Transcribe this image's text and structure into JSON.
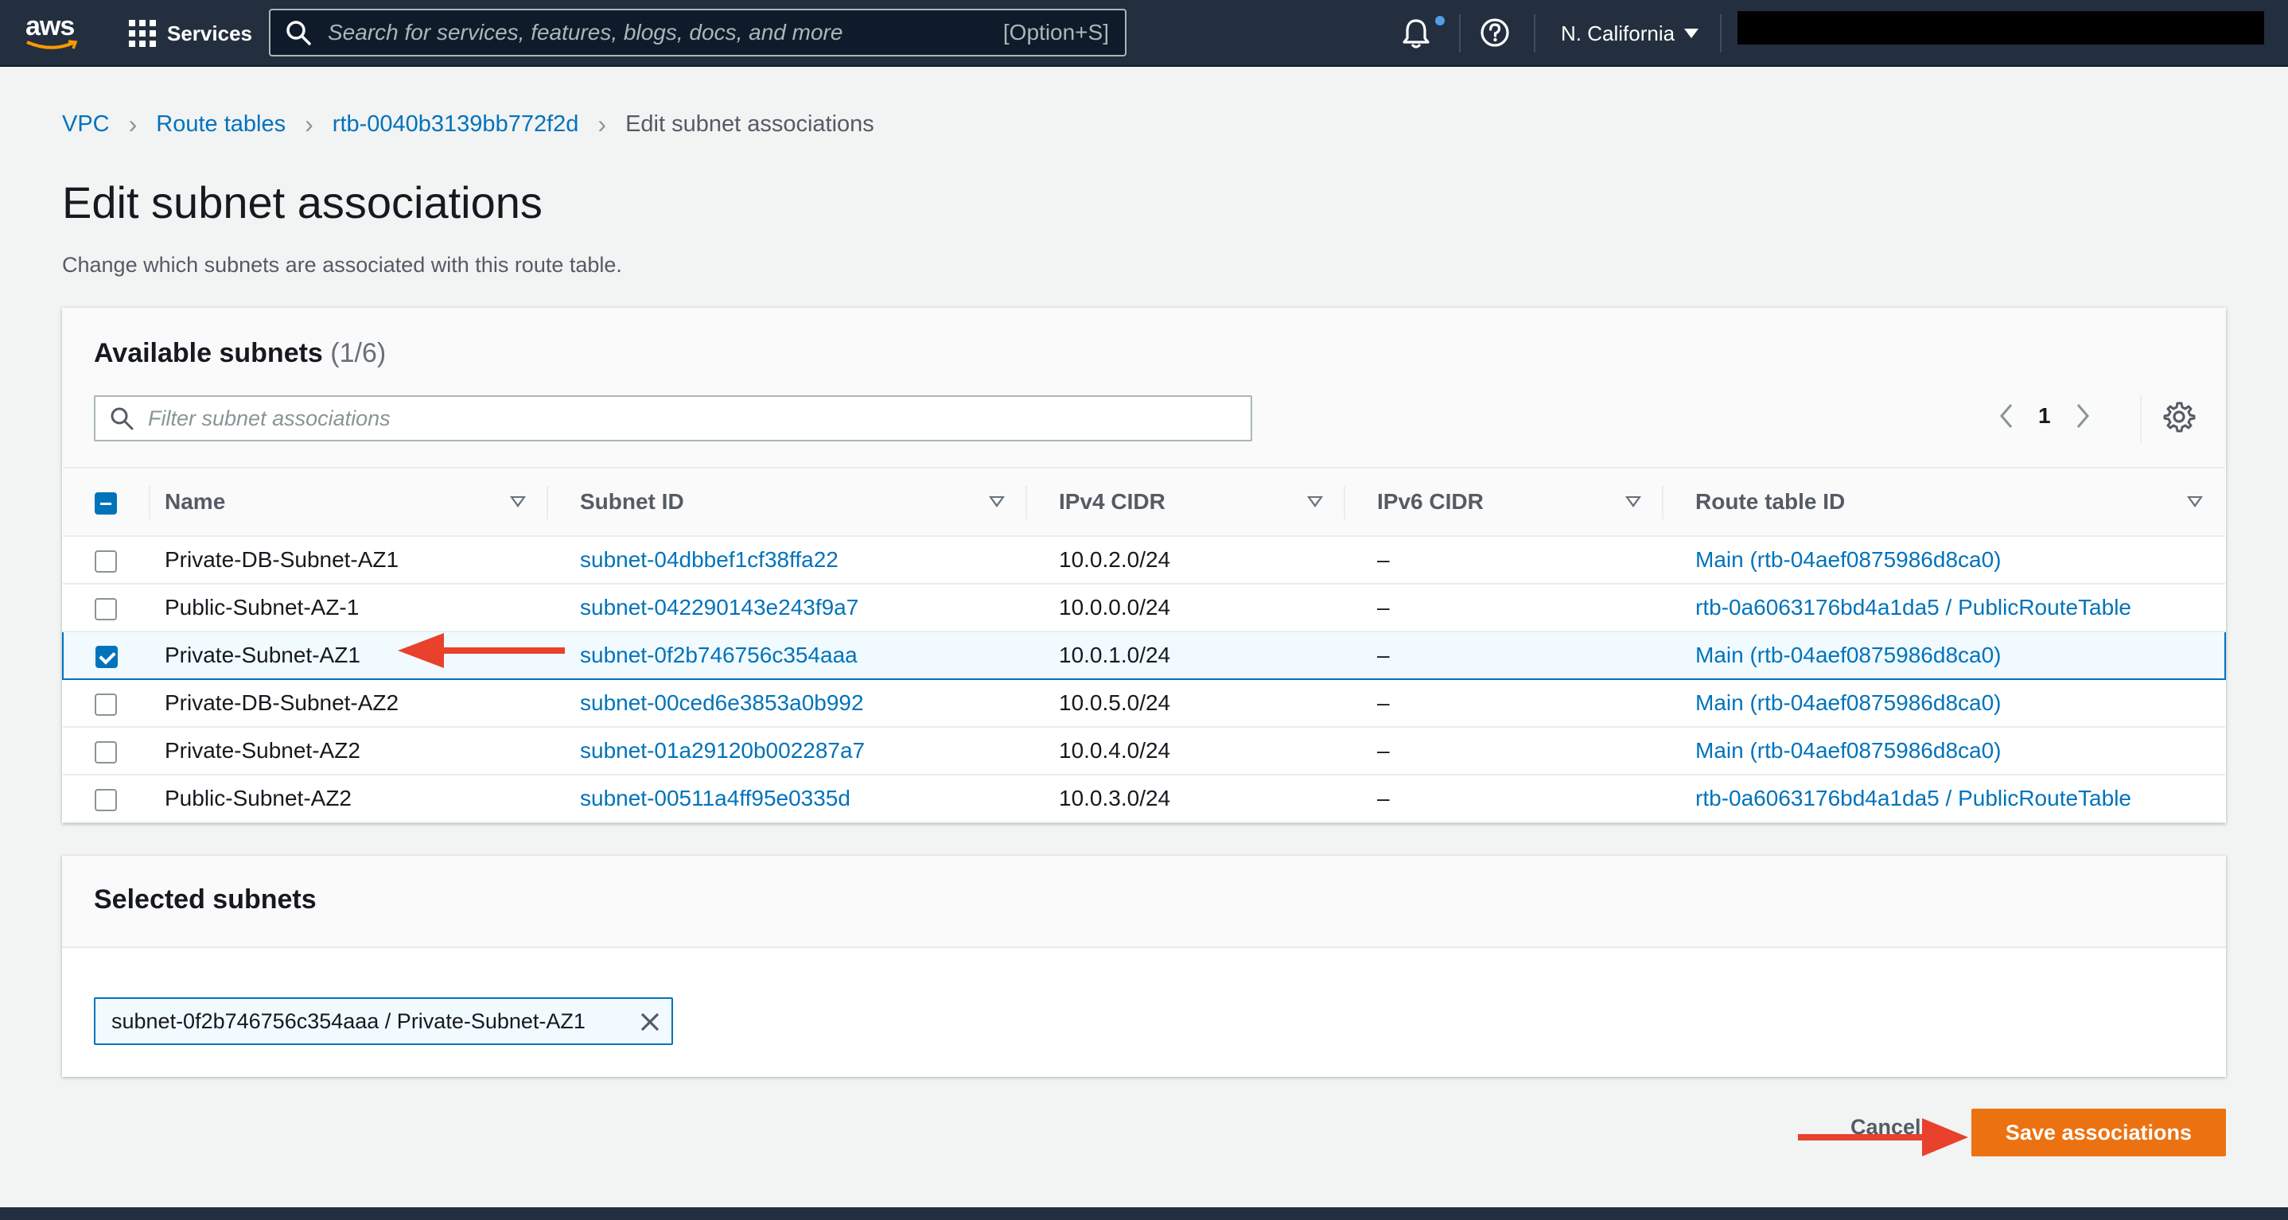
{
  "nav": {
    "logo": "aws",
    "services_label": "Services",
    "search_placeholder": "Search for services, features, blogs, docs, and more",
    "search_shortcut": "[Option+S]",
    "region": "N. California"
  },
  "breadcrumb": {
    "items": [
      "VPC",
      "Route tables",
      "rtb-0040b3139bb772f2d"
    ],
    "current": "Edit subnet associations"
  },
  "page": {
    "title": "Edit subnet associations",
    "description": "Change which subnets are associated with this route table."
  },
  "available": {
    "title": "Available subnets",
    "count": "(1/6)",
    "filter_placeholder": "Filter subnet associations",
    "page_number": "1",
    "columns": [
      "Name",
      "Subnet ID",
      "IPv4 CIDR",
      "IPv6 CIDR",
      "Route table ID"
    ],
    "rows": [
      {
        "name": "Private-DB-Subnet-AZ1",
        "subnet_id": "subnet-04dbbef1cf38ffa22",
        "ipv4": "10.0.2.0/24",
        "ipv6": "–",
        "route_table": "Main (rtb-04aef0875986d8ca0)",
        "checked": false
      },
      {
        "name": "Public-Subnet-AZ-1",
        "subnet_id": "subnet-042290143e243f9a7",
        "ipv4": "10.0.0.0/24",
        "ipv6": "–",
        "route_table": "rtb-0a6063176bd4a1da5 / PublicRouteTable",
        "checked": false
      },
      {
        "name": "Private-Subnet-AZ1",
        "subnet_id": "subnet-0f2b746756c354aaa",
        "ipv4": "10.0.1.0/24",
        "ipv6": "–",
        "route_table": "Main (rtb-04aef0875986d8ca0)",
        "checked": true
      },
      {
        "name": "Private-DB-Subnet-AZ2",
        "subnet_id": "subnet-00ced6e3853a0b992",
        "ipv4": "10.0.5.0/24",
        "ipv6": "–",
        "route_table": "Main (rtb-04aef0875986d8ca0)",
        "checked": false
      },
      {
        "name": "Private-Subnet-AZ2",
        "subnet_id": "subnet-01a29120b002287a7",
        "ipv4": "10.0.4.0/24",
        "ipv6": "–",
        "route_table": "Main (rtb-04aef0875986d8ca0)",
        "checked": false
      },
      {
        "name": "Public-Subnet-AZ2",
        "subnet_id": "subnet-00511a4ff95e0335d",
        "ipv4": "10.0.3.0/24",
        "ipv6": "–",
        "route_table": "rtb-0a6063176bd4a1da5 / PublicRouteTable",
        "checked": false
      }
    ]
  },
  "selected": {
    "title": "Selected subnets",
    "token": "subnet-0f2b746756c354aaa / Private-Subnet-AZ1"
  },
  "actions": {
    "cancel": "Cancel",
    "save": "Save associations"
  },
  "colors": {
    "nav_bg": "#232f3e",
    "link": "#0073bb",
    "primary_button": "#ec7211",
    "annotation_arrow": "#e8412c"
  }
}
